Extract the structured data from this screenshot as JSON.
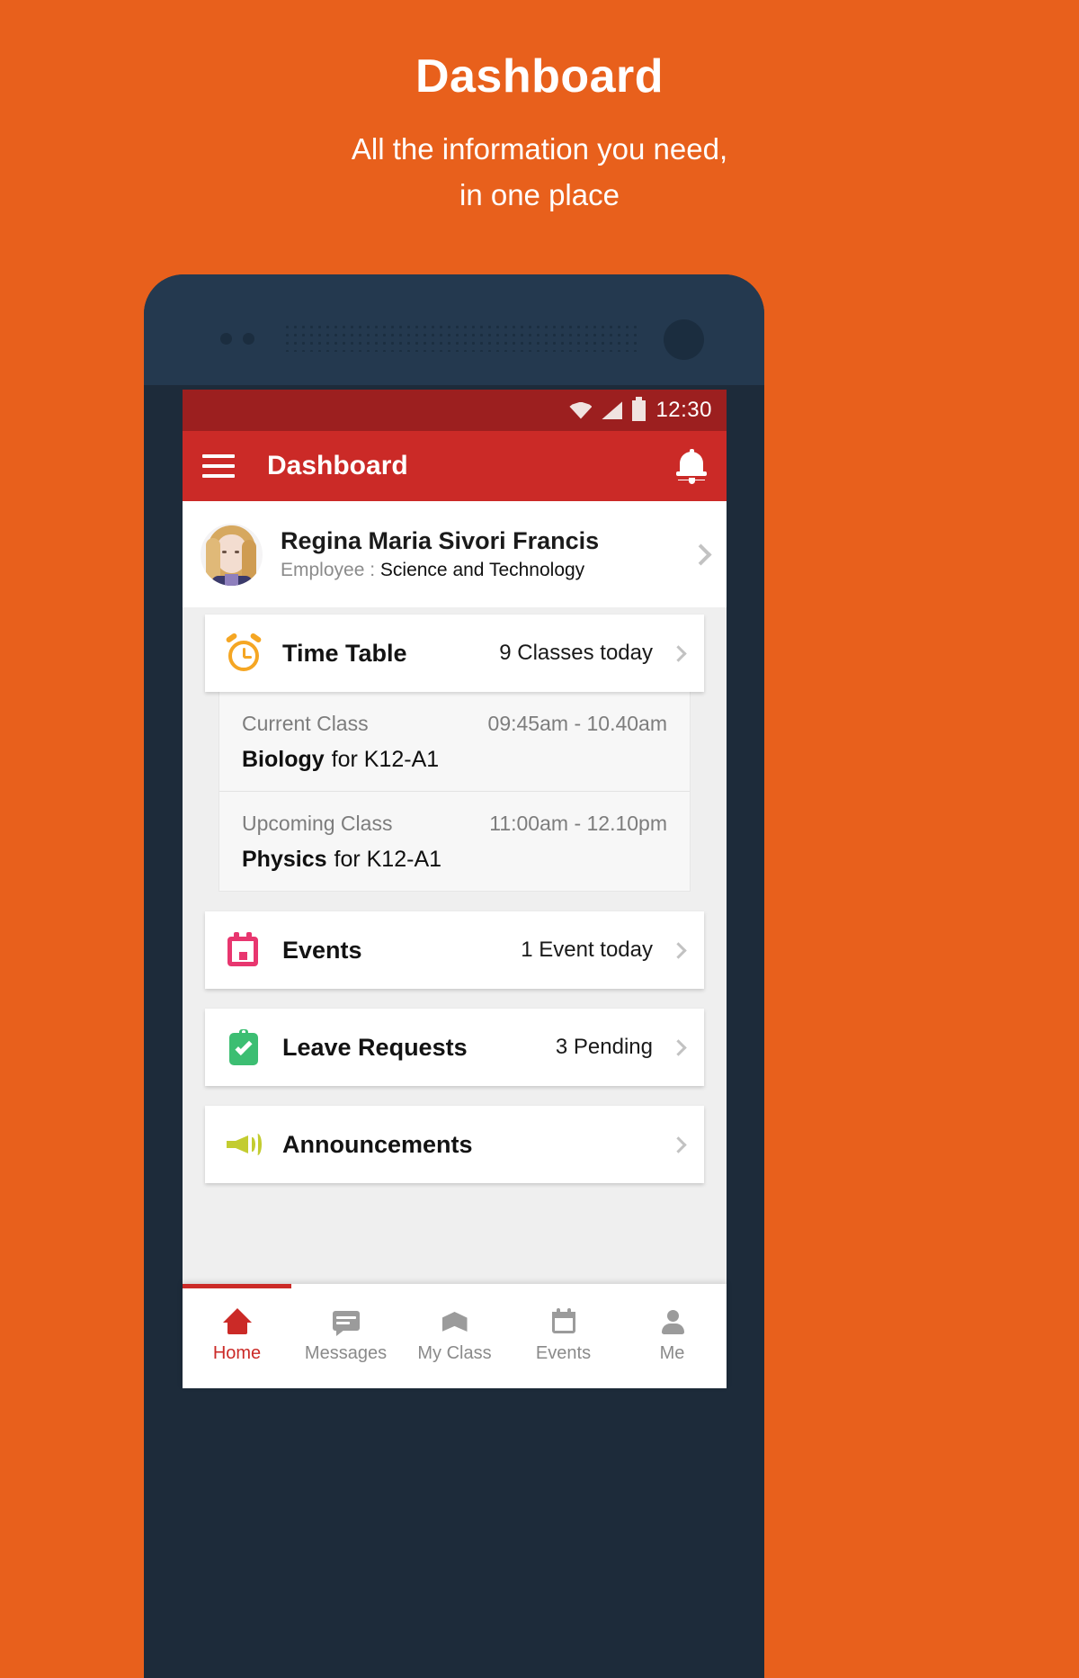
{
  "promo": {
    "title": "Dashboard",
    "subtitle_line1": "All the information you need,",
    "subtitle_line2": "in one place"
  },
  "colors": {
    "background": "#E8601C",
    "appbar": "#CB2A27",
    "statusbar": "#9C1F1F",
    "phone_body": "#24394F",
    "accent_alarm": "#F5A623",
    "accent_calendar": "#E8366F",
    "accent_check": "#3CBE72",
    "accent_megaphone": "#C3CC30"
  },
  "statusbar": {
    "time": "12:30",
    "wifi_icon": "wifi-icon",
    "signal_icon": "signal-icon",
    "battery_icon": "battery-icon"
  },
  "appbar": {
    "menu_icon": "hamburger-menu-icon",
    "title": "Dashboard",
    "notification_icon": "bell-icon"
  },
  "profile": {
    "name": "Regina Maria Sivori Francis",
    "role_label": "Employee :",
    "role_value": "Science and Technology",
    "chevron_icon": "chevron-right-icon"
  },
  "cards": {
    "timetable": {
      "icon": "alarm-clock-icon",
      "title": "Time Table",
      "meta": "9 Classes today",
      "chevron_icon": "chevron-right-icon"
    },
    "events": {
      "icon": "calendar-icon",
      "title": "Events",
      "meta": "1 Event today",
      "chevron_icon": "chevron-right-icon"
    },
    "leave": {
      "icon": "clipboard-check-icon",
      "title": "Leave Requests",
      "meta": "3 Pending",
      "chevron_icon": "chevron-right-icon"
    },
    "announcements": {
      "icon": "megaphone-icon",
      "title": "Announcements",
      "meta": "",
      "chevron_icon": "chevron-right-icon"
    }
  },
  "classes": [
    {
      "label": "Current Class",
      "time": "09:45am - 10.40am",
      "subject": "Biology",
      "section": "for K12-A1"
    },
    {
      "label": "Upcoming Class",
      "time": "11:00am - 12.10pm",
      "subject": "Physics",
      "section": "for K12-A1"
    }
  ],
  "bottom_nav": {
    "items": [
      {
        "label": "Home",
        "icon": "home-icon",
        "active": true
      },
      {
        "label": "Messages",
        "icon": "message-icon",
        "active": false
      },
      {
        "label": "My Class",
        "icon": "book-icon",
        "active": false
      },
      {
        "label": "Events",
        "icon": "calendar-icon",
        "active": false
      },
      {
        "label": "Me",
        "icon": "person-icon",
        "active": false
      }
    ]
  }
}
